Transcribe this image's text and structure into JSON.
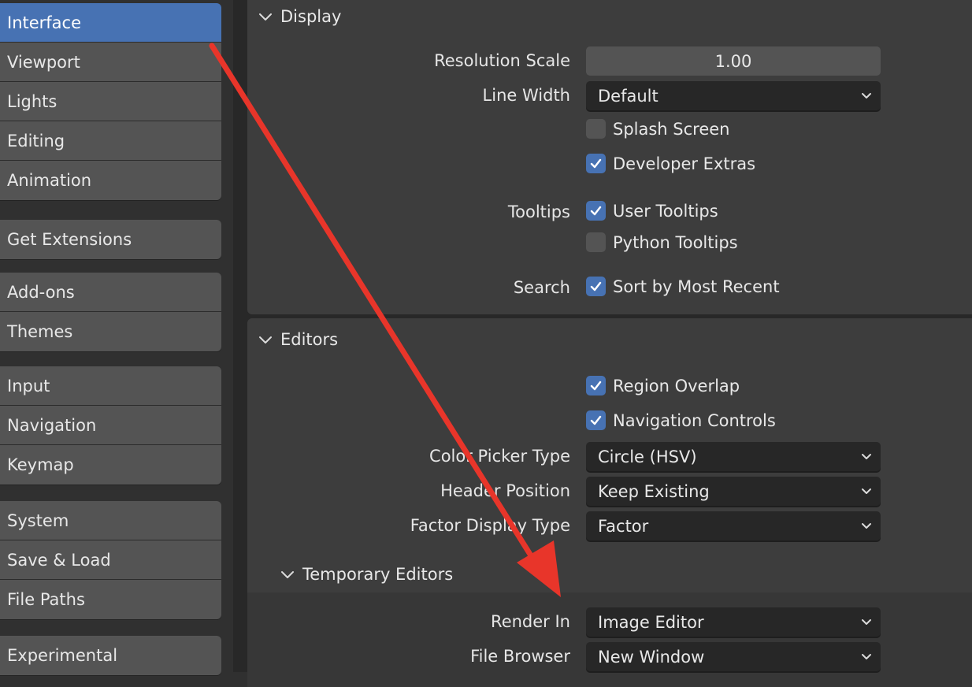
{
  "sidebar": {
    "groups": [
      [
        "Interface",
        "Viewport",
        "Lights",
        "Editing",
        "Animation"
      ],
      [
        "Get Extensions"
      ],
      [
        "Add-ons",
        "Themes"
      ],
      [
        "Input",
        "Navigation",
        "Keymap"
      ],
      [
        "System",
        "Save & Load",
        "File Paths"
      ],
      [
        "Experimental"
      ]
    ],
    "active": "Interface"
  },
  "display": {
    "title": "Display",
    "resolution_scale": {
      "label": "Resolution Scale",
      "value": "1.00"
    },
    "line_width": {
      "label": "Line Width",
      "value": "Default"
    },
    "splash_screen": {
      "label": "Splash Screen",
      "checked": false
    },
    "developer_extras": {
      "label": "Developer Extras",
      "checked": true
    },
    "tooltips": {
      "label": "Tooltips",
      "user_tooltips": {
        "label": "User Tooltips",
        "checked": true
      },
      "python_tooltips": {
        "label": "Python Tooltips",
        "checked": false
      }
    },
    "search": {
      "label": "Search",
      "sort_by_most_recent": {
        "label": "Sort by Most Recent",
        "checked": true
      }
    }
  },
  "editors": {
    "title": "Editors",
    "region_overlap": {
      "label": "Region Overlap",
      "checked": true
    },
    "navigation_controls": {
      "label": "Navigation Controls",
      "checked": true
    },
    "color_picker_type": {
      "label": "Color Picker Type",
      "value": "Circle (HSV)"
    },
    "header_position": {
      "label": "Header Position",
      "value": "Keep Existing"
    },
    "factor_display_type": {
      "label": "Factor Display Type",
      "value": "Factor"
    },
    "temporary_editors": {
      "title": "Temporary Editors",
      "render_in": {
        "label": "Render In",
        "value": "Image Editor"
      },
      "file_browser": {
        "label": "File Browser",
        "value": "New Window"
      }
    }
  },
  "colors": {
    "accent": "#4772b3",
    "annotation_arrow": "#e8352a"
  }
}
